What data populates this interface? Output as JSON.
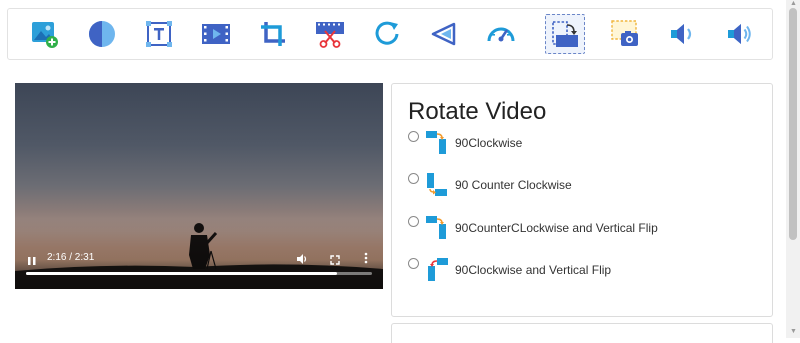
{
  "toolbar": {
    "tools": [
      {
        "icon": "add-image-icon"
      },
      {
        "icon": "color-adjust-icon"
      },
      {
        "icon": "add-text-icon"
      },
      {
        "icon": "video-clip-icon"
      },
      {
        "icon": "crop-icon"
      },
      {
        "icon": "cut-video-icon"
      },
      {
        "icon": "loop-icon"
      },
      {
        "icon": "reverse-icon"
      },
      {
        "icon": "speed-icon"
      },
      {
        "icon": "rotate-video-icon",
        "active": true
      },
      {
        "icon": "screenshot-icon"
      },
      {
        "icon": "volume-low-icon"
      },
      {
        "icon": "volume-high-icon"
      }
    ]
  },
  "player": {
    "time": "2:16 / 2:31",
    "progress": 0.9
  },
  "rotate_panel": {
    "title": "Rotate Video",
    "options": [
      {
        "label": "90Clockwise"
      },
      {
        "label": "90 Counter Clockwise"
      },
      {
        "label": "90CounterCLockwise and Vertical Flip"
      },
      {
        "label": "90Clockwise and Vertical Flip"
      }
    ]
  },
  "colors": {
    "accent": "#3f63c4",
    "icon_blue": "#1e9bd8",
    "icon_orange": "#f29b2e"
  }
}
